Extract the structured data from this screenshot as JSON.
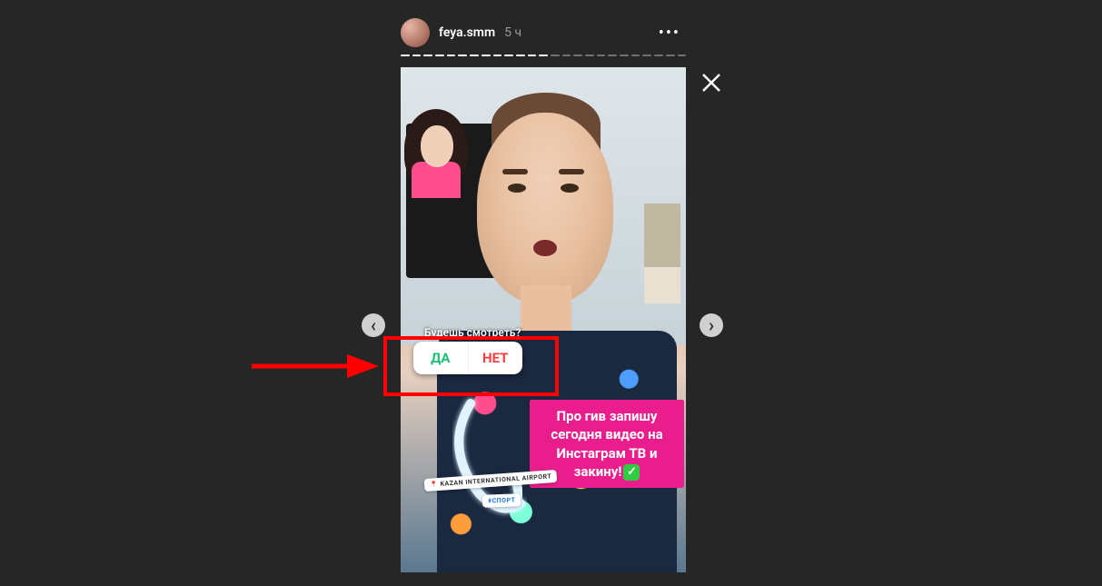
{
  "header": {
    "username": "feya.smm",
    "time": "5 ч",
    "progress": {
      "total": 25,
      "done": 13
    }
  },
  "poll": {
    "question": "Будешь смотреть?",
    "yes": "ДА",
    "no": "НЕТ"
  },
  "caption": {
    "text": "Про гив запишу сегодня видео на Инстаграм ТВ и закину!",
    "checkmark": "✓"
  },
  "chips": {
    "location": "📍 KAZAN INTERNATIONAL AIRPORT",
    "hashtag": "#СПОРТ"
  },
  "icons": {
    "more": "•••",
    "close": "✕",
    "prev": "‹",
    "next": "›"
  },
  "colors": {
    "accent_pink": "#e91e8c",
    "poll_yes": "#1fbf75",
    "poll_no": "#ff3b3b",
    "highlight": "#ff0000"
  }
}
